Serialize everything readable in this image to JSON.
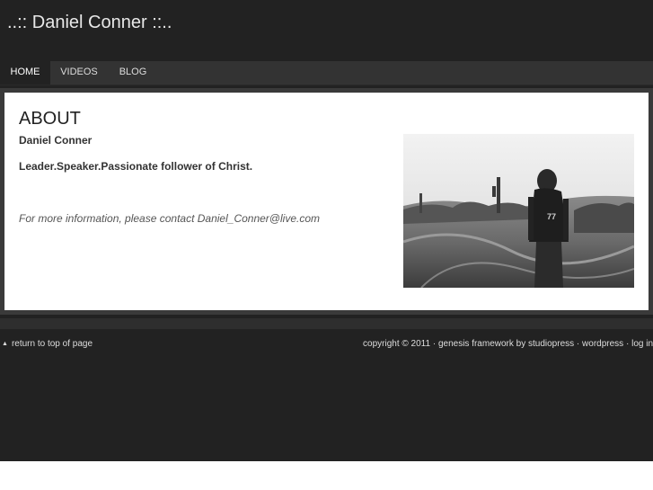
{
  "header": {
    "site_title": "..:: Daniel Conner ::.."
  },
  "nav": {
    "items": [
      {
        "label": "HOME",
        "active": true
      },
      {
        "label": "VIDEOS",
        "active": false
      },
      {
        "label": "BLOG",
        "active": false
      }
    ]
  },
  "main": {
    "title": "ABOUT",
    "name": "Daniel Conner",
    "tagline": "Leader.Speaker.Passionate follower of Christ.",
    "contact": "For more information, please contact Daniel_Conner@live.com",
    "photo_icon": "profile-photo"
  },
  "footer": {
    "back_to_top": "return to top of page",
    "copyright": "copyright © 2011",
    "sep": "·",
    "genesis": "genesis framework",
    "by": "by",
    "studiopress": "studiopress",
    "wordpress": "wordpress",
    "login": "log in"
  },
  "colors": {
    "page_bg": "#222222",
    "nav_bg": "#333333",
    "content_bg": "#ffffff",
    "text_light": "#dddddd"
  }
}
